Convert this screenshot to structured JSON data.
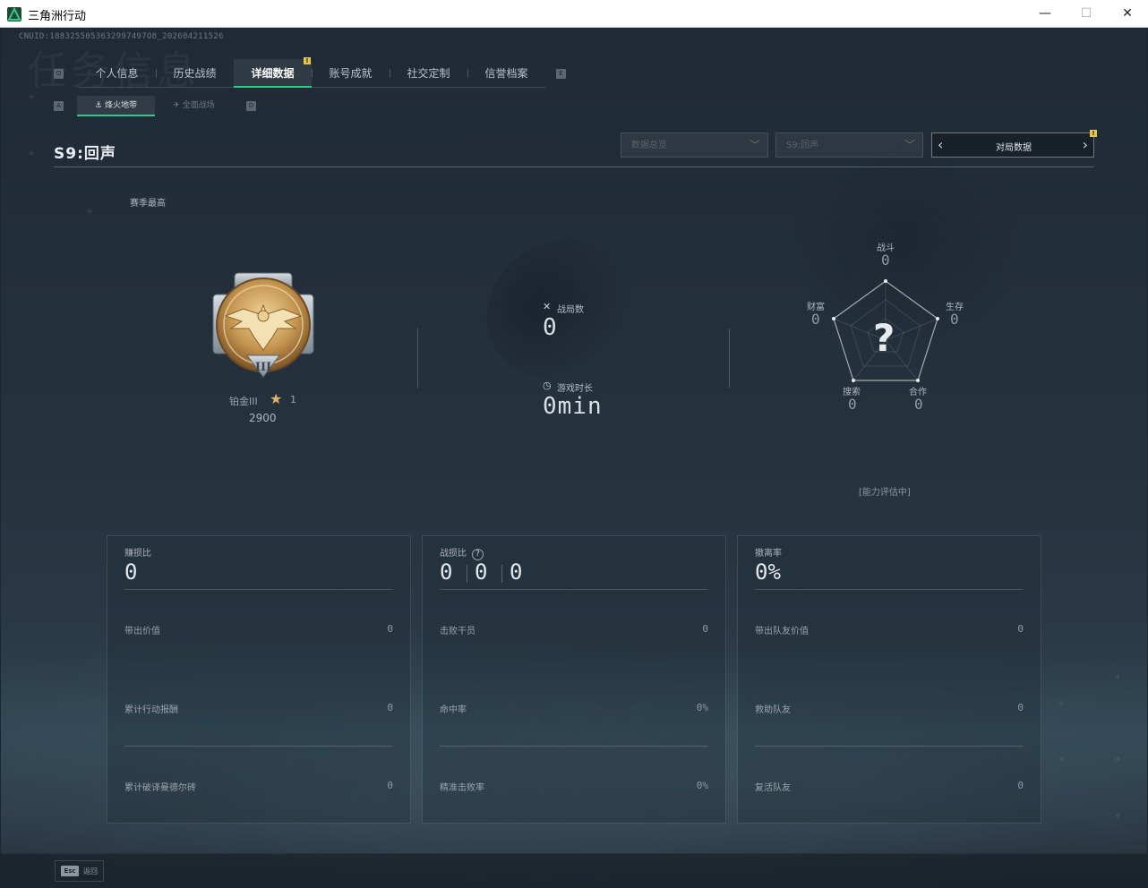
{
  "window": {
    "title": "三角洲行动"
  },
  "header": {
    "cnuid": "CNUID:1883255053632997497O8_202604211526",
    "watermark": "任务信息"
  },
  "tabs": [
    {
      "label": "个人信息",
      "active": false
    },
    {
      "label": "历史战绩",
      "active": false
    },
    {
      "label": "详细数据",
      "active": true,
      "badge": "!"
    },
    {
      "label": "账号成就",
      "active": false
    },
    {
      "label": "社交定制",
      "active": false
    },
    {
      "label": "信誉档案",
      "active": false
    }
  ],
  "tab_key_left": "Q",
  "tab_key_right": "E",
  "subtabs": [
    {
      "label": "烽火地带",
      "active": true,
      "icon": "hazard-zone-icon"
    },
    {
      "label": "全面战场",
      "active": false,
      "icon": "battlefield-icon"
    }
  ],
  "subtab_key_left": "A",
  "subtab_key_right": "D",
  "season": {
    "title": "S9:回声",
    "best_label": "赛季最高"
  },
  "filters": {
    "data_type": "数据总览",
    "season": "S9:回声",
    "match_data": "对局数据",
    "match_badge": "!"
  },
  "rank": {
    "name": "铂金III",
    "stars": "1",
    "score": "2900",
    "tier_numeral": "III"
  },
  "stats": {
    "matches_label": "战局数",
    "matches_value": "0",
    "playtime_label": "游戏时长",
    "playtime_value": "0min"
  },
  "radar": {
    "unknown_mark": "?",
    "axes": [
      {
        "label": "战斗",
        "value": "0"
      },
      {
        "label": "生存",
        "value": "0"
      },
      {
        "label": "合作",
        "value": "0"
      },
      {
        "label": "搜索",
        "value": "0"
      },
      {
        "label": "财富",
        "value": "0"
      }
    ],
    "status": "[能力评估中]"
  },
  "panels": [
    {
      "title": "赚损比",
      "big": "0",
      "rows": [
        {
          "label": "带出价值",
          "value": "0"
        },
        {
          "label": "累计行动报酬",
          "value": "0"
        },
        {
          "label": "累计破译曼德尔砖",
          "value": "0"
        }
      ]
    },
    {
      "title": "战损比",
      "big_values": [
        "0",
        "0",
        "0"
      ],
      "rows": [
        {
          "label": "击败干员",
          "value": "0"
        },
        {
          "label": "命中率",
          "value": "0%"
        },
        {
          "label": "精准击败率",
          "value": "0%"
        }
      ]
    },
    {
      "title": "撤离率",
      "big": "0%",
      "rows": [
        {
          "label": "带出队友价值",
          "value": "0"
        },
        {
          "label": "救助队友",
          "value": "0"
        },
        {
          "label": "复活队友",
          "value": "0"
        }
      ]
    }
  ],
  "footer": {
    "esc_key": "Esc",
    "esc_label": "返回"
  },
  "colors": {
    "accent": "#3bc78a",
    "badge": "#e8c547",
    "gold": "#d9b46a"
  }
}
